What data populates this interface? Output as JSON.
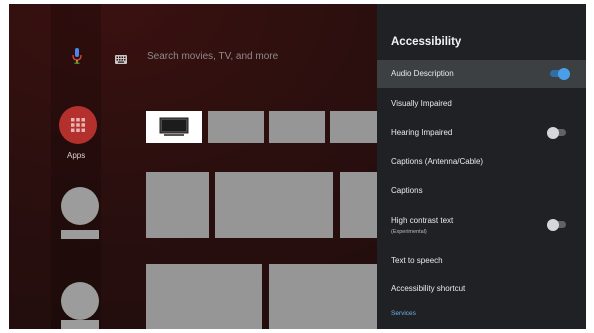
{
  "search": {
    "placeholder": "Search movies, TV, and more"
  },
  "sidebar": {
    "apps_label": "Apps"
  },
  "accessibility_panel": {
    "title": "Accessibility",
    "items": [
      {
        "label": "Audio Description",
        "sublabel": "",
        "toggle": "on"
      },
      {
        "label": "Visually Impaired",
        "sublabel": "",
        "toggle": "none"
      },
      {
        "label": "Hearing Impaired",
        "sublabel": "",
        "toggle": "off"
      },
      {
        "label": "Captions (Antenna/Cable)",
        "sublabel": "",
        "toggle": "none"
      },
      {
        "label": "Captions",
        "sublabel": "",
        "toggle": "none"
      },
      {
        "label": "High contrast text",
        "sublabel": "(Experimental)",
        "toggle": "off"
      },
      {
        "label": "Text to speech",
        "sublabel": "",
        "toggle": "none"
      },
      {
        "label": "Accessibility shortcut",
        "sublabel": "",
        "toggle": "none"
      }
    ],
    "section_label": "Services"
  },
  "colors": {
    "accent_blue": "#4a9fe8",
    "apps_red": "#b3302c",
    "panel_bg": "#202124"
  },
  "icons": {
    "mic": "mic-icon",
    "keyboard": "keyboard-icon",
    "apps": "apps-grid-icon",
    "tv": "tv-icon"
  }
}
